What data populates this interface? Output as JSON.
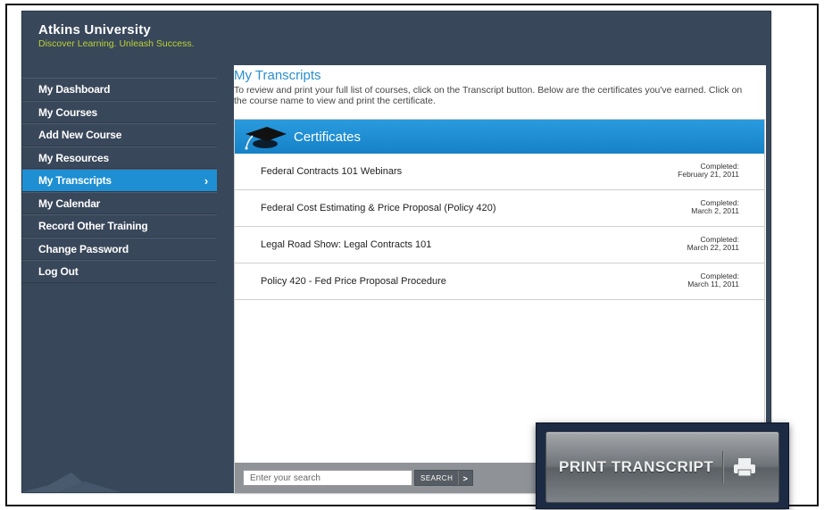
{
  "brand": {
    "name": "Atkins University",
    "tagline": "Discover Learning. Unleash Success."
  },
  "sidebar": {
    "items": [
      {
        "label": "My Dashboard"
      },
      {
        "label": "My Courses"
      },
      {
        "label": "Add New Course"
      },
      {
        "label": "My Resources"
      },
      {
        "label": "My Transcripts",
        "active": true
      },
      {
        "label": "My Calendar"
      },
      {
        "label": "Record Other Training"
      },
      {
        "label": "Change Password"
      },
      {
        "label": "Log Out"
      }
    ],
    "active_icon": "chevron-right-icon"
  },
  "main": {
    "title": "My Transcripts",
    "intro": "To review and print your full list of courses, click on the Transcript button. Below are the certificates you've earned. Click on the course name to view and print the certificate.",
    "certificates": {
      "header": "Certificates",
      "header_icon": "graduation-cap-icon",
      "rows": [
        {
          "name": "Federal Contracts 101 Webinars",
          "completed_label": "Completed:",
          "date": "February 21, 2011"
        },
        {
          "name": "Federal Cost Estimating & Price Proposal (Policy 420)",
          "completed_label": "Completed:",
          "date": "March 2, 2011"
        },
        {
          "name": "Legal Road Show: Legal Contracts 101",
          "completed_label": "Completed:",
          "date": "March 22, 2011"
        },
        {
          "name": "Policy 420 - Fed Price Proposal Procedure",
          "completed_label": "Completed:",
          "date": "March 11, 2011"
        }
      ]
    }
  },
  "search": {
    "placeholder": "Enter your search",
    "button_label": "SEARCH",
    "button_icon": "chevron-right-icon"
  },
  "print": {
    "label": "PRINT TRANSCRIPT",
    "icon": "printer-icon"
  },
  "colors": {
    "sidebar_bg": "#39475a",
    "accent_blue": "#1e8fd2",
    "tagline_green": "#b8d234",
    "title_blue": "#2a8fd0"
  }
}
